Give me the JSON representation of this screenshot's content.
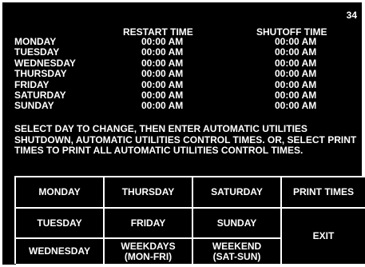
{
  "page_number": "34",
  "headers": {
    "restart": "RESTART TIME",
    "shutoff": "SHUTOFF TIME"
  },
  "schedule": [
    {
      "day": "MONDAY",
      "restart": "00:00 AM",
      "shutoff": "00:00 AM"
    },
    {
      "day": "TUESDAY",
      "restart": "00:00 AM",
      "shutoff": "00:00 AM"
    },
    {
      "day": "WEDNESDAY",
      "restart": "00:00 AM",
      "shutoff": "00:00 AM"
    },
    {
      "day": "THURSDAY",
      "restart": "00:00 AM",
      "shutoff": "00:00 AM"
    },
    {
      "day": "FRIDAY",
      "restart": "00:00 AM",
      "shutoff": "00:00 AM"
    },
    {
      "day": "SATURDAY",
      "restart": "00:00 AM",
      "shutoff": "00:00 AM"
    },
    {
      "day": "SUNDAY",
      "restart": "00:00 AM",
      "shutoff": "00:00 AM"
    }
  ],
  "instructions": "SELECT DAY TO CHANGE, THEN ENTER AUTOMATIC UTILITIES SHUTDOWN, AUTOMATIC UTILITIES CONTROL TIMES. OR, SELECT PRINT TIMES TO PRINT ALL AUTOMATIC UTILITIES CONTROL TIMES.",
  "buttons": {
    "monday": "MONDAY",
    "thursday": "THURSDAY",
    "saturday": "SATURDAY",
    "print_times": "PRINT TIMES",
    "tuesday": "TUESDAY",
    "friday": "FRIDAY",
    "sunday": "SUNDAY",
    "exit": "EXIT",
    "wednesday": "WEDNESDAY",
    "weekdays": {
      "line1": "WEEKDAYS",
      "line2": "(MON-FRI)"
    },
    "weekend": {
      "line1": "WEEKEND",
      "line2": "(SAT-SUN)"
    }
  },
  "colors": {
    "background": "#000000",
    "foreground": "#ffffff"
  }
}
